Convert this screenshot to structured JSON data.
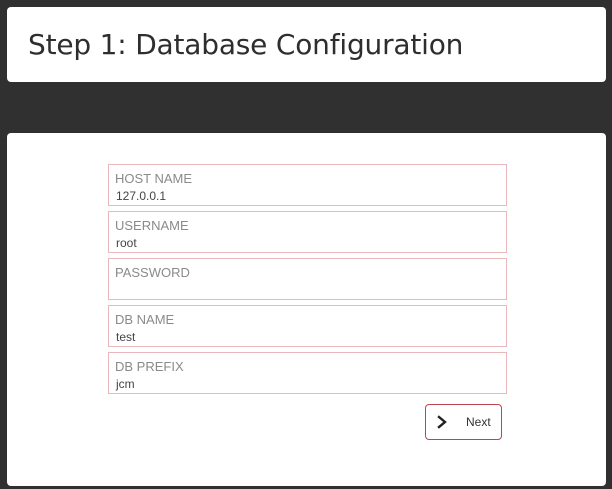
{
  "header": {
    "title": "Step 1: Database Configuration"
  },
  "form": {
    "fields": [
      {
        "label": "HOST NAME",
        "value": "127.0.0.1"
      },
      {
        "label": "USERNAME",
        "value": "root"
      },
      {
        "label": "PASSWORD",
        "value": ""
      },
      {
        "label": "DB NAME",
        "value": "test"
      },
      {
        "label": "DB PREFIX",
        "value": "jcm"
      }
    ],
    "next_label": "Next",
    "next_icon": "chevron-right-icon"
  },
  "colors": {
    "background": "#303030",
    "card": "#ffffff",
    "field_border": "#e8b8bc",
    "button_border": "#c0444c"
  }
}
